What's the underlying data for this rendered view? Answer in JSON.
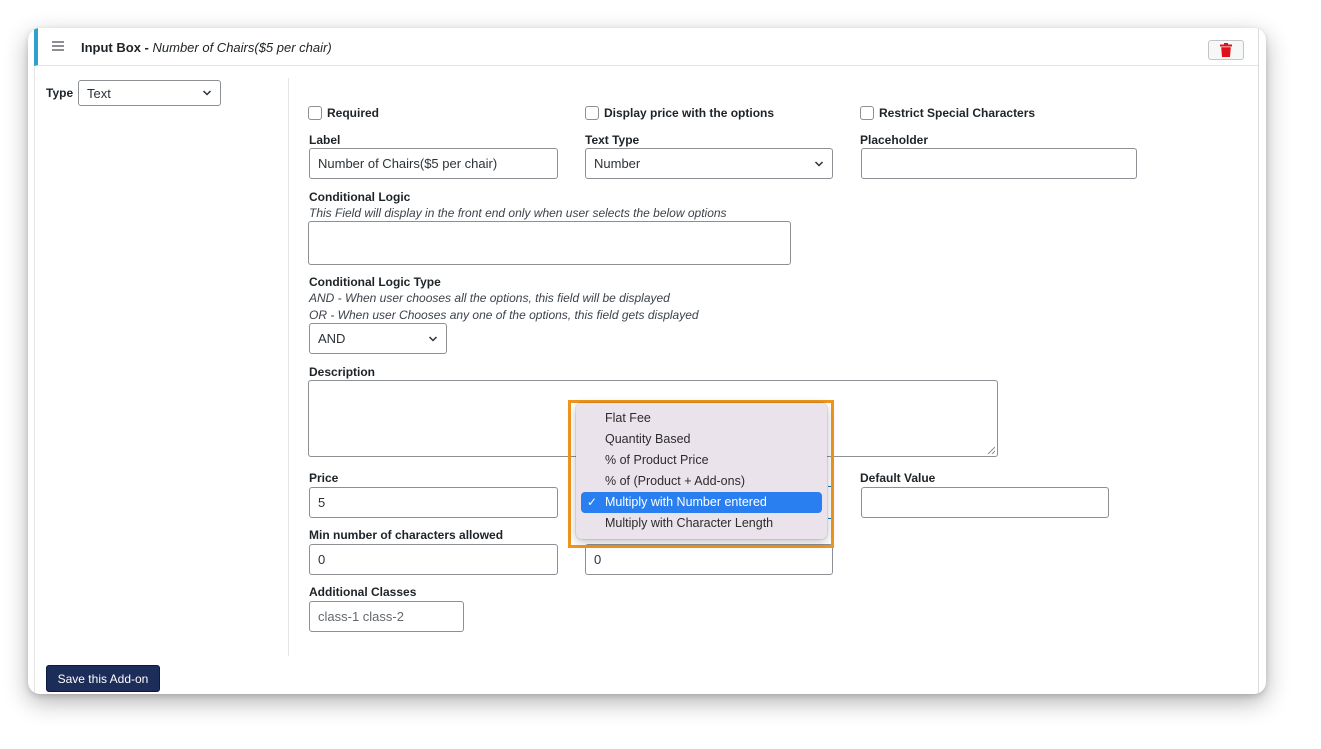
{
  "header": {
    "title": "Input Box - ",
    "subtitle": "Number of Chairs($5 per chair)"
  },
  "type_field": {
    "label": "Type",
    "value": "Text"
  },
  "checkboxes": {
    "required": "Required",
    "display_price": "Display price with the options",
    "restrict_special": "Restrict Special Characters"
  },
  "label_field": {
    "label": "Label",
    "value": "Number of Chairs($5 per chair)"
  },
  "text_type_field": {
    "label": "Text Type",
    "value": "Number"
  },
  "placeholder_field": {
    "label": "Placeholder",
    "value": ""
  },
  "conditional_logic": {
    "label": "Conditional Logic",
    "help": "This Field will display in the front end only when user selects the below options"
  },
  "conditional_logic_type": {
    "label": "Conditional Logic Type",
    "help_and": "AND - When user chooses all the options, this field will be displayed",
    "help_or": "OR - When user Chooses any one of the options, this field gets displayed",
    "value": "AND"
  },
  "description_field": {
    "label": "Description",
    "value": ""
  },
  "price_field": {
    "label": "Price",
    "value": "5"
  },
  "default_value_field": {
    "label": "Default Value",
    "value": ""
  },
  "min_chars_field": {
    "label": "Min number of characters allowed",
    "value": "0"
  },
  "max_chars_field": {
    "value": "0"
  },
  "additional_classes": {
    "label": "Additional Classes",
    "placeholder": "class-1 class-2"
  },
  "save_button": "Save this Add-on",
  "price_type_dropdown": {
    "options": [
      "Flat Fee",
      "Quantity Based",
      "% of Product Price",
      "% of (Product + Add-ons)",
      "Multiply with Number entered",
      "Multiply with Character Length"
    ],
    "selected": "Multiply with Number entered",
    "check_glyph": "✓"
  },
  "colors": {
    "accent": "#2ea2cc",
    "save_button": "#1d2d5a",
    "delete_icon": "#e0111a",
    "highlight": "#f0961e",
    "selected_option": "#2a7ff0"
  }
}
